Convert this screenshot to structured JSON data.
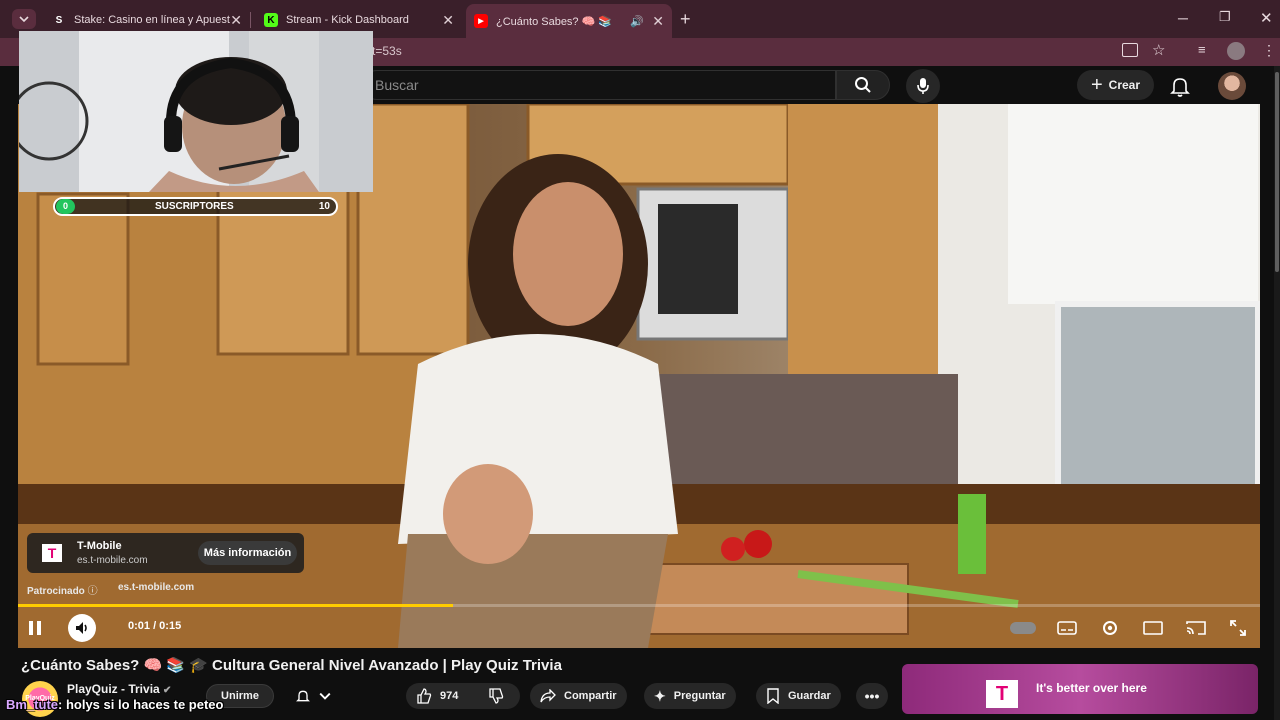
{
  "browser": {
    "tabs": [
      {
        "label": "Stake: Casino en línea y Apuest",
        "icon": "stake-favicon-icon"
      },
      {
        "label": "Stream - Kick Dashboard",
        "icon": "kick-favicon-icon"
      },
      {
        "label": "¿Cuánto Sabes? 🧠 📚 🎓 C",
        "icon": "youtube-favicon-icon"
      }
    ],
    "url_fragment": "t=53s"
  },
  "youtube_header": {
    "search_placeholder": "Buscar",
    "create_label": "Crear"
  },
  "overlay": {
    "subs_label": "SUSCRIPTORES",
    "subs_current": "0",
    "subs_goal": "10"
  },
  "ad": {
    "brand": "T-Mobile",
    "url": "es.t-mobile.com",
    "cta": "Más información",
    "sponsored_label": "Patrocinado",
    "sponsored_url": "es.t-mobile.com"
  },
  "player": {
    "time": "0:01 / 0:15",
    "progress": 0.35
  },
  "video": {
    "title": "¿Cuánto Sabes? 🧠 📚 🎓 Cultura General Nivel Avanzado | Play Quiz Trivia",
    "channel": "PlayQuiz - Trivia",
    "channel_logo_text": "PlayQuiz",
    "join_label": "Unirme",
    "likes": "974",
    "share_label": "Compartir",
    "ask_label": "Preguntar",
    "save_label": "Guardar"
  },
  "chat": {
    "user": "Bm_tute",
    "message": ": holys si lo haces te peteo"
  },
  "side_ad": {
    "logo": "T",
    "text": "It's better over here"
  },
  "colors": {
    "tab_bar": "#3a1f2a",
    "progress": "#ffcc00",
    "t_mobile": "#e20074"
  }
}
